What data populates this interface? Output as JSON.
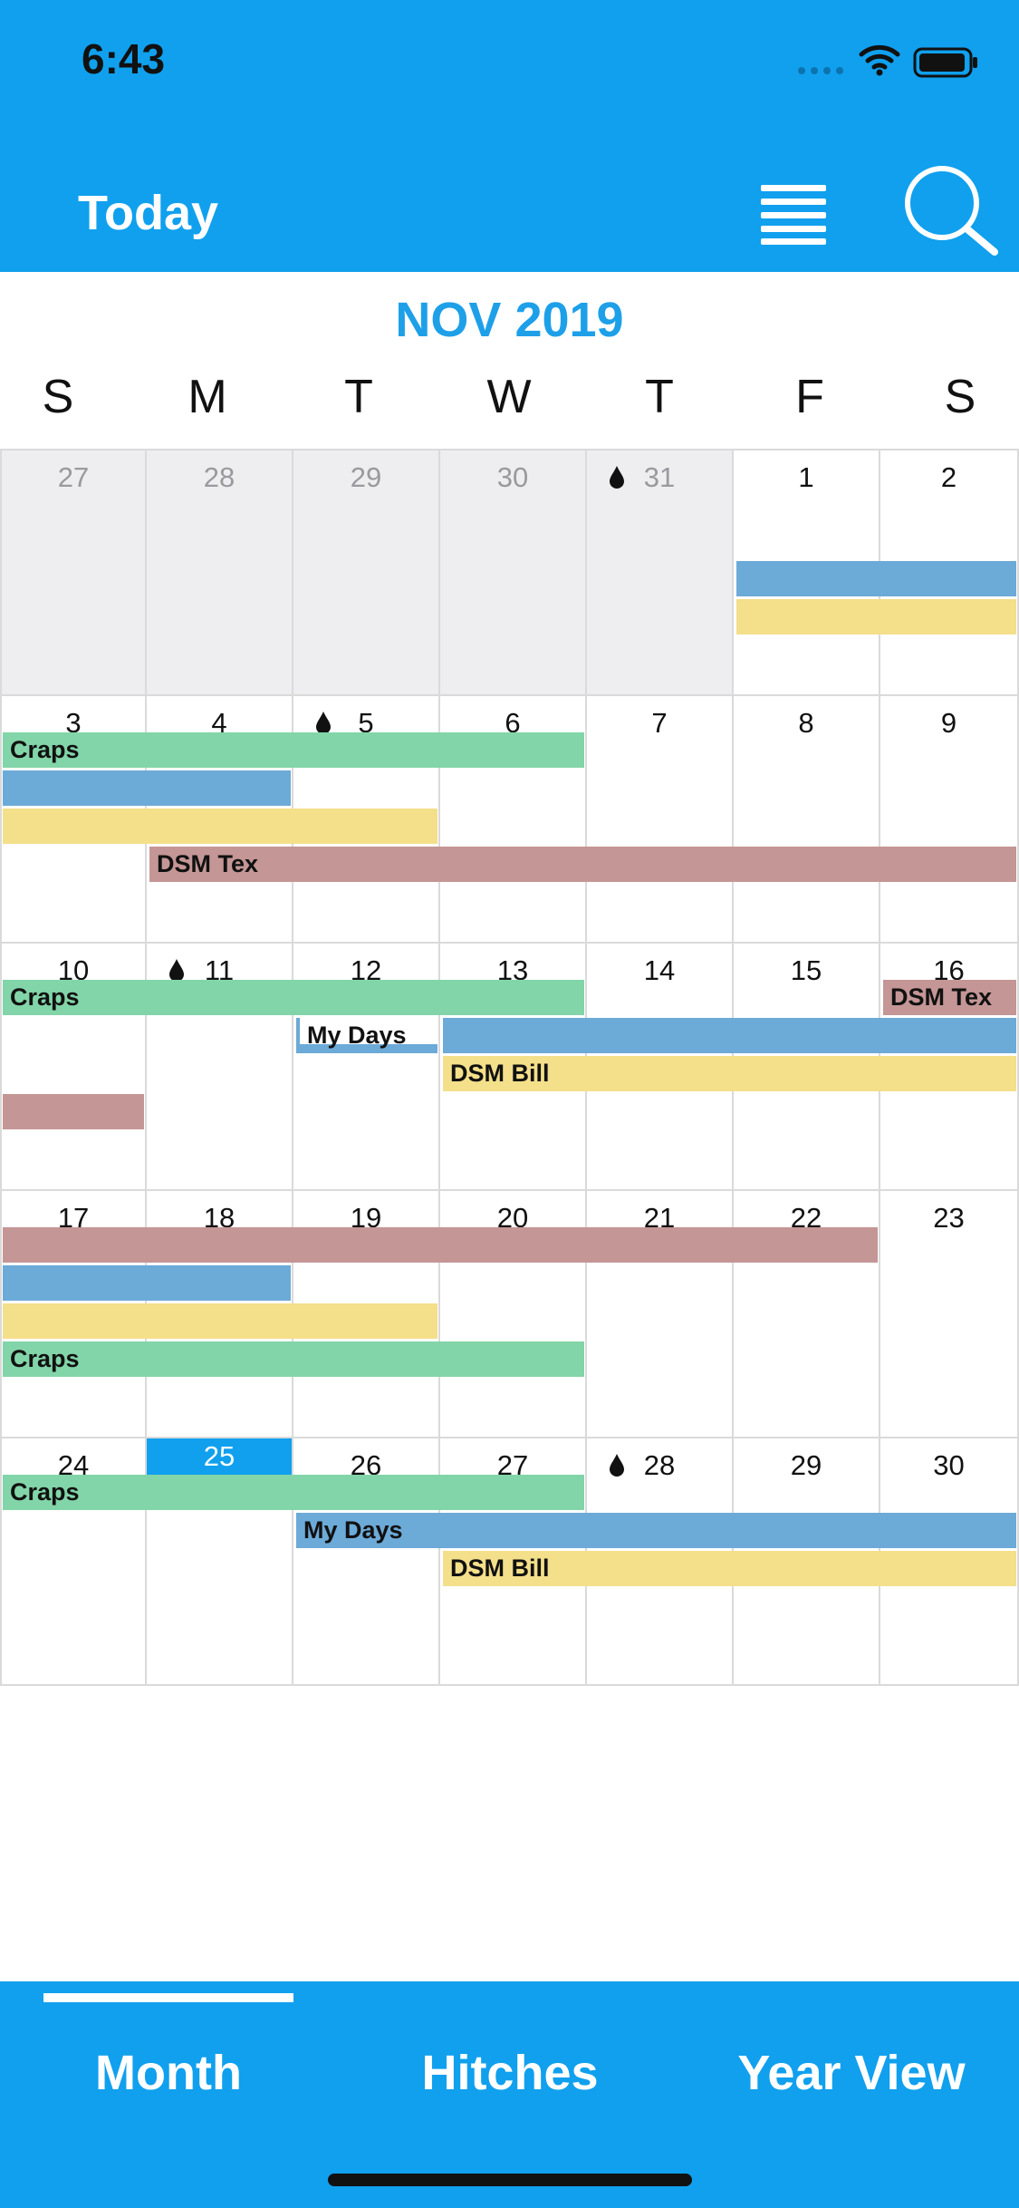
{
  "status": {
    "time": "6:43"
  },
  "header": {
    "today_label": "Today"
  },
  "calendar": {
    "month_title": "NOV 2019",
    "weekdays": [
      "S",
      "M",
      "T",
      "W",
      "T",
      "F",
      "S"
    ],
    "rows": [
      [
        "27",
        "28",
        "29",
        "30",
        "31",
        "1",
        "2"
      ],
      [
        "3",
        "4",
        "5",
        "6",
        "7",
        "8",
        "9"
      ],
      [
        "10",
        "11",
        "12",
        "13",
        "14",
        "15",
        "16"
      ],
      [
        "17",
        "18",
        "19",
        "20",
        "21",
        "22",
        "23"
      ],
      [
        "24",
        "25",
        "26",
        "27",
        "28",
        "29",
        "30"
      ]
    ],
    "other_month_cells": [
      [
        0,
        0
      ],
      [
        0,
        1
      ],
      [
        0,
        2
      ],
      [
        0,
        3
      ],
      [
        0,
        4
      ]
    ],
    "today_cell": [
      4,
      1
    ],
    "drop_cells": [
      [
        0,
        4
      ],
      [
        1,
        2
      ],
      [
        2,
        1
      ],
      [
        4,
        4
      ]
    ],
    "events": [
      {
        "week": 0,
        "start": 5,
        "end": 6,
        "lane": 2,
        "color": "blue",
        "label": ""
      },
      {
        "week": 0,
        "start": 5,
        "end": 6,
        "lane": 3,
        "color": "yellow",
        "label": ""
      },
      {
        "week": 1,
        "start": 0,
        "end": 3,
        "lane": 0,
        "color": "green",
        "label": "Craps"
      },
      {
        "week": 1,
        "start": 0,
        "end": 1,
        "lane": 1,
        "color": "blue",
        "label": ""
      },
      {
        "week": 1,
        "start": 0,
        "end": 2,
        "lane": 2,
        "color": "yellow",
        "label": ""
      },
      {
        "week": 1,
        "start": 1,
        "end": 6,
        "lane": 3,
        "color": "red",
        "label": "DSM Tex"
      },
      {
        "week": 2,
        "start": 0,
        "end": 3,
        "lane": 0,
        "color": "green",
        "label": "Craps"
      },
      {
        "week": 2,
        "start": 6,
        "end": 6,
        "lane": 0,
        "color": "red",
        "label": "DSM Tex"
      },
      {
        "week": 2,
        "start": 2,
        "end": 2,
        "lane": 1,
        "color": "blue",
        "label": "My Days",
        "style": "underline"
      },
      {
        "week": 2,
        "start": 3,
        "end": 6,
        "lane": 1,
        "color": "blue",
        "label": ""
      },
      {
        "week": 2,
        "start": 3,
        "end": 6,
        "lane": 2,
        "color": "yellow",
        "label": "DSM Bill"
      },
      {
        "week": 2,
        "start": 0,
        "end": 0,
        "lane": 3,
        "color": "red",
        "label": ""
      },
      {
        "week": 3,
        "start": 0,
        "end": 5,
        "lane": 0,
        "color": "red",
        "label": ""
      },
      {
        "week": 3,
        "start": 0,
        "end": 1,
        "lane": 1,
        "color": "blue",
        "label": ""
      },
      {
        "week": 3,
        "start": 0,
        "end": 2,
        "lane": 2,
        "color": "yellow",
        "label": ""
      },
      {
        "week": 3,
        "start": 0,
        "end": 3,
        "lane": 3,
        "color": "green",
        "label": "Craps"
      },
      {
        "week": 4,
        "start": 0,
        "end": 3,
        "lane": 0,
        "color": "green",
        "label": "Craps"
      },
      {
        "week": 4,
        "start": 2,
        "end": 6,
        "lane": 1,
        "color": "blue",
        "label": "My Days"
      },
      {
        "week": 4,
        "start": 3,
        "end": 6,
        "lane": 2,
        "color": "yellow",
        "label": "DSM Bill"
      }
    ],
    "colors": {
      "green": "#82D5A8",
      "blue": "#6CAAD8",
      "yellow": "#F4DF8A",
      "red": "#C49695",
      "accent": "#10A0EE"
    }
  },
  "tabs": [
    {
      "label": "Month",
      "selected": true
    },
    {
      "label": "Hitches",
      "selected": false
    },
    {
      "label": "Year View",
      "selected": false
    }
  ],
  "icons": {
    "menu": "hamburger-menu-icon",
    "search": "magnifier-search-icon",
    "drop": "water-drop-icon",
    "wifi": "wifi-icon",
    "battery": "battery-icon",
    "signal": "cellular-signal-icon"
  }
}
